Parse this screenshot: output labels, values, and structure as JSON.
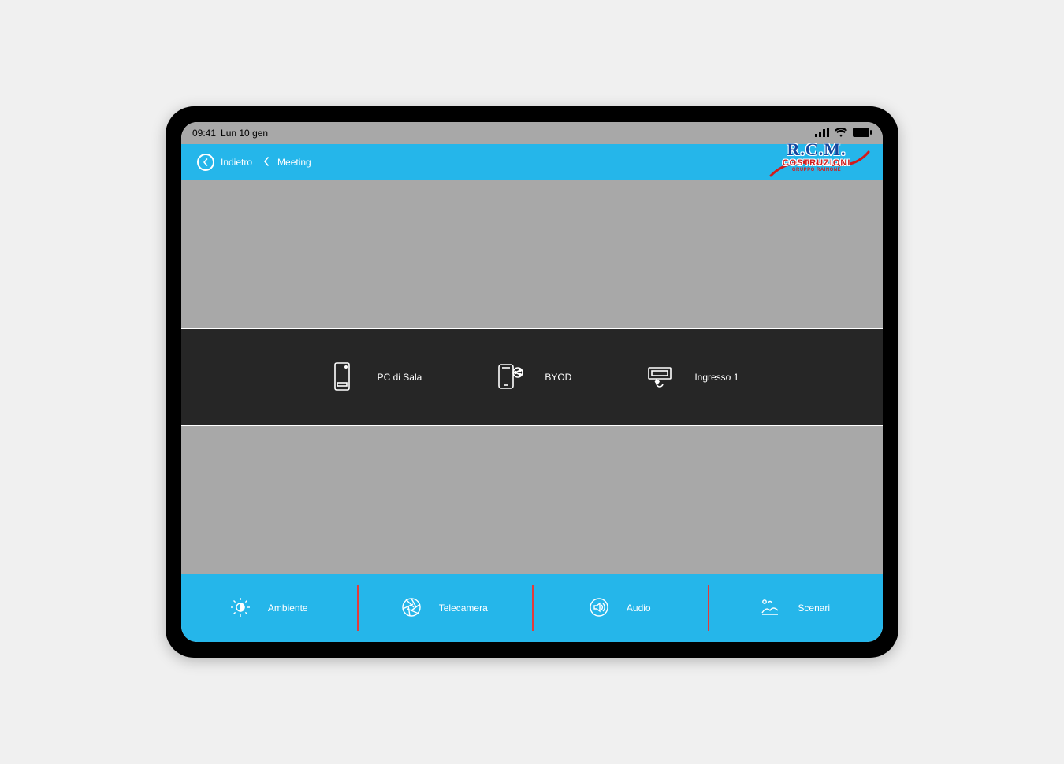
{
  "status": {
    "time": "09:41",
    "date": "Lun 10 gen"
  },
  "header": {
    "back_label": "Indietro",
    "crumb": "Meeting"
  },
  "logo": {
    "line1": "R.C.M.",
    "line2": "COSTRUZIONI",
    "line3": "GRUPPO RAINONE"
  },
  "sources": [
    {
      "label": "PC di Sala",
      "icon": "desktop-pc-icon"
    },
    {
      "label": "BYOD",
      "icon": "device-share-icon"
    },
    {
      "label": "Ingresso 1",
      "icon": "hdmi-input-icon"
    }
  ],
  "footer": [
    {
      "label": "Ambiente",
      "icon": "brightness-icon"
    },
    {
      "label": "Telecamera",
      "icon": "aperture-icon"
    },
    {
      "label": "Audio",
      "icon": "speaker-icon"
    },
    {
      "label": "Scenari",
      "icon": "scene-icon"
    }
  ]
}
